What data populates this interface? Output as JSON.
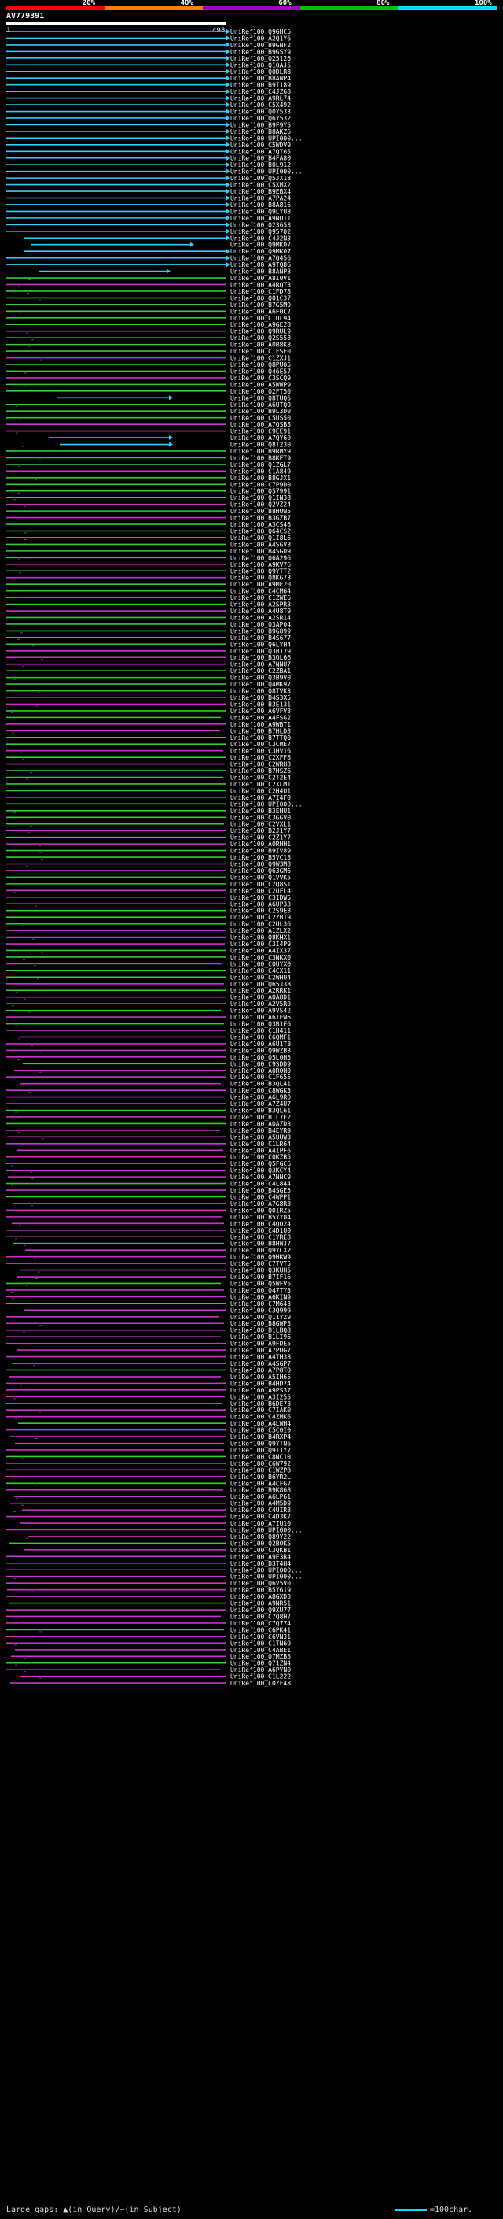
{
  "query": {
    "id": "AV779391",
    "start": "1",
    "end": "498"
  },
  "legend": {
    "labels": [
      "20%",
      "40%",
      "60%",
      "80%",
      "100%"
    ],
    "colors": [
      "#ff0000",
      "#ff8000",
      "#a000c0",
      "#00c000",
      "#00e0ff"
    ]
  },
  "colors": {
    "blue": "#33ccff",
    "green": "#33cc33",
    "magenta": "#cc33cc",
    "black": "#000000",
    "white": "#ffffff"
  },
  "footer": {
    "gaps_label": "Large gaps: ▲(in Query)/~(in Subject)",
    "scale_label": "=100char."
  },
  "hits": [
    "UniRef100_Q9GHC5",
    "UniRef100_A2Q1Y6",
    "UniRef100_B9GNF2",
    "UniRef100_B9GSY9",
    "UniRef100_Q25126",
    "UniRef100_Q10AJ5",
    "UniRef100_Q0DLR8",
    "UniRef100_B8AWP4",
    "UniRef100_B9I189",
    "UniRef100_C4JZ68",
    "UniRef100_A9RL74",
    "UniRef100_C5X492",
    "UniRef100_Q0Y533",
    "UniRef100_Q6Y532",
    "UniRef100_B9F9Y5",
    "UniRef100_B8AKZ6",
    "UniRef100_UPI000...",
    "UniRef100_C5WDV9",
    "UniRef100_A7QT65",
    "UniRef100_B4FA80",
    "UniRef100_B0L912",
    "UniRef100_UPI000...",
    "UniRef100_Q5JX18",
    "UniRef100_C5XMX2",
    "UniRef100_B9EBX4",
    "UniRef100_A7PA24",
    "UniRef100_B8A816",
    "UniRef100_Q9LYU8",
    "UniRef100_A9NU11",
    "UniRef100_Q23653",
    "UniRef100_Q95702",
    "UniRef100_C4J2N3",
    "UniRef100_Q9MK07",
    "UniRef100_Q9MK07",
    "UniRef100_A7Q456",
    "UniRef100_A9TQ86",
    "UniRef100_B8ANP3",
    "UniRef100_A8I0V1",
    "UniRef100_A4RQT3",
    "UniRef100_C1FD78",
    "UniRef100_Q01C37",
    "UniRef100_B7G5M9",
    "UniRef100_A6F0C7",
    "UniRef100_C1UL94",
    "UniRef100_A9GE28",
    "UniRef100_Q9RUL9",
    "UniRef100_Q2S558",
    "UniRef100_A0B8K8",
    "UniRef100_C1FSF0",
    "UniRef100_C1ZXJ1",
    "UniRef100_Q8PU05",
    "UniRef100_Q46E57",
    "UniRef100_C3SCQ9",
    "UniRef100_A5WWP9",
    "UniRef100_Q2FT50",
    "UniRef100_Q8TUQ6",
    "UniRef100_A6UTQ9",
    "UniRef100_B9L3D0",
    "UniRef100_C5US50",
    "UniRef100_A7QSB3",
    "UniRef100_C9EE91",
    "UniRef100_A7QY60",
    "UniRef100_Q8T230",
    "UniRef100_B9RMY9",
    "UniRef100_B8KET9",
    "UniRef100_Q1ZGL7",
    "UniRef100_C1A849",
    "UniRef100_B8GJX1",
    "UniRef100_C7P9D0",
    "UniRef100_Q57991",
    "UniRef100_Q1IN38",
    "UniRef100_Q2VZ24",
    "UniRef100_B8HUW5",
    "UniRef100_B3GZB7",
    "UniRef100_A3CS46",
    "UniRef100_Q64CS2",
    "UniRef100_Q1I8L6",
    "UniRef100_A4SGV3",
    "UniRef100_B4SGD9",
    "UniRef100_Q6A296",
    "UniRef100_A9KV76",
    "UniRef100_Q9YTT2",
    "UniRef100_Q8KG73",
    "UniRef100_A9ME20",
    "UniRef100_C4CM64",
    "UniRef100_C1ZWE6",
    "UniRef100_A2SPR3",
    "UniRef100_A4U8T9",
    "UniRef100_A2SR14",
    "UniRef100_Q3AP04",
    "UniRef100_B9G899",
    "UniRef100_B4S677",
    "UniRef100_Q6LYH4",
    "UniRef100_Q3B179",
    "UniRef100_B3QL66",
    "UniRef100_A7NNU7",
    "UniRef100_C2ZBA1",
    "UniRef100_Q3B9V0",
    "UniRef100_Q4MK97",
    "UniRef100_Q8TVK3",
    "UniRef100_B4S3X5",
    "UniRef100_B3E131",
    "UniRef100_A6VFV3",
    "UniRef100_A4FSG2",
    "UniRef100_A9WBT1",
    "UniRef100_B7HLD3",
    "UniRef100_B7TTQ0",
    "UniRef100_C3CME7",
    "UniRef100_C3HV16",
    "UniRef100_C2XFF8",
    "UniRef100_C2WRH8",
    "UniRef100_B7HSZ6",
    "UniRef100_C2T2E4",
    "UniRef100_C2XLM1",
    "UniRef100_C2H4U1",
    "UniRef100_A7I4F0",
    "UniRef100_UPI000...",
    "UniRef100_B3EHU1",
    "UniRef100_C3GGV0",
    "UniRef100_C2VXL1",
    "UniRef100_B2J1Y7",
    "UniRef100_C2Z1Y7",
    "UniRef100_A0RHH1",
    "UniRef100_B9IV89",
    "UniRef100_B5VC13",
    "UniRef100_Q9W3M8",
    "UniRef100_Q63GM6",
    "UniRef100_Q1VVK5",
    "UniRef100_C2Q8S1",
    "UniRef100_C2UFL4",
    "UniRef100_C3IDW5",
    "UniRef100_A6UP33",
    "UniRef100_C2S9E3",
    "UniRef100_C2ZB19",
    "UniRef100_C2UL36",
    "UniRef100_A1ZLX2",
    "UniRef100_Q8KHX1",
    "UniRef100_C3I4P9",
    "UniRef100_A4IX37",
    "UniRef100_C3NKX0",
    "UniRef100_C0UYX0",
    "UniRef100_C4CX11",
    "UniRef100_C2WHU4",
    "UniRef100_Q65J38",
    "UniRef100_A2RRK1",
    "UniRef100_A0A8D1",
    "UniRef100_A2V5R0",
    "UniRef100_A9VS42",
    "UniRef100_A6TEW6",
    "UniRef100_Q3B1F6",
    "UniRef100_C1H411",
    "UniRef100_C6QMF1",
    "UniRef100_A6U1T8",
    "UniRef100_Q9WZB3",
    "UniRef100_Q5L0H5",
    "UniRef100_C9SDD9",
    "UniRef100_A0R0H0",
    "UniRef100_C1F655",
    "UniRef100_B3QL41",
    "UniRef100_C8WGK3",
    "UniRef100_A6L9R0",
    "UniRef100_A7Z4U7",
    "UniRef100_B3QL61",
    "UniRef100_B1L7E2",
    "UniRef100_A0AZD3",
    "UniRef100_B4EYR9",
    "UniRef100_A5UUW3",
    "UniRef100_C1LR64",
    "UniRef100_A4IPF6",
    "UniRef100_C0KZB5",
    "UniRef100_Q5FGC6",
    "UniRef100_Q3KCY4",
    "UniRef100_A7NNC9",
    "UniRef100_C4L844",
    "UniRef100_B4SGE5",
    "UniRef100_C4WPP1",
    "UniRef100_A7G8R3",
    "UniRef100_Q0IRZ5",
    "UniRef100_B5YY04",
    "UniRef100_C4QO24",
    "UniRef100_C4D1U0",
    "UniRef100_C1YRE8",
    "UniRef100_B8HWJ7",
    "UniRef100_Q9YCX2",
    "UniRef100_Q9HKW9",
    "UniRef100_C7TVT5",
    "UniRef100_Q3KUH5",
    "UniRef100_B7IF16",
    "UniRef100_Q5WFV5",
    "UniRef100_Q47TY3",
    "UniRef100_A6KIN9",
    "UniRef100_C7M643",
    "UniRef100_C3Q999",
    "UniRef100_Q11YZ9",
    "UniRef100_B8GWP3",
    "UniRef100_B1LBQ8",
    "UniRef100_B1LI96",
    "UniRef100_A9FDE5",
    "UniRef100_A7PDG7",
    "UniRef100_A4TH38",
    "UniRef100_A4SGP7",
    "UniRef100_A7P8T0",
    "UniRef100_A5IH65",
    "UniRef100_B4HD74",
    "UniRef100_A9PS37",
    "UniRef100_A3I255",
    "UniRef100_B6DE73",
    "UniRef100_C7IAK0",
    "UniRef100_C4ZMK6",
    "UniRef100_A4LWH4",
    "UniRef100_C5C0I0",
    "UniRef100_B4RXP4",
    "UniRef100_Q9YTN6",
    "UniRef100_Q9T1Y7",
    "UniRef100_C8NC10",
    "UniRef100_C6W792",
    "UniRef100_C1WZP8",
    "UniRef100_B6YR2L",
    "UniRef100_A4CFG7",
    "UniRef100_B9K868",
    "UniRef100_A6LP61",
    "UniRef100_A4M5D9",
    "UniRef100_C4UIR8",
    "UniRef100_C4D3K7",
    "UniRef100_A7IU10",
    "UniRef100_UPI000...",
    "UniRef100_Q89Y22",
    "UniRef100_Q2BOK5",
    "UniRef100_C3QKB1",
    "UniRef100_A9E3R4",
    "UniRef100_B3T4H4",
    "UniRef100_UPI000...",
    "UniRef100_UPI000...",
    "UniRef100_Q6V5V0",
    "UniRef100_B5Y619",
    "UniRef100_A8GXD3",
    "UniRef100_A9NR51",
    "UniRef100_Q9XU77",
    "UniRef100_C7Q8H7",
    "UniRef100_C7Q774",
    "UniRef100_C6PK41",
    "UniRef100_C6VN31",
    "UniRef100_C1TN69",
    "UniRef100_C4ABE1",
    "UniRef100_Q7MZB3",
    "UniRef100_Q71ZN4",
    "UniRef100_A6PYN0",
    "UniRef100_C1L222",
    "UniRef100_C0ZF48"
  ]
}
